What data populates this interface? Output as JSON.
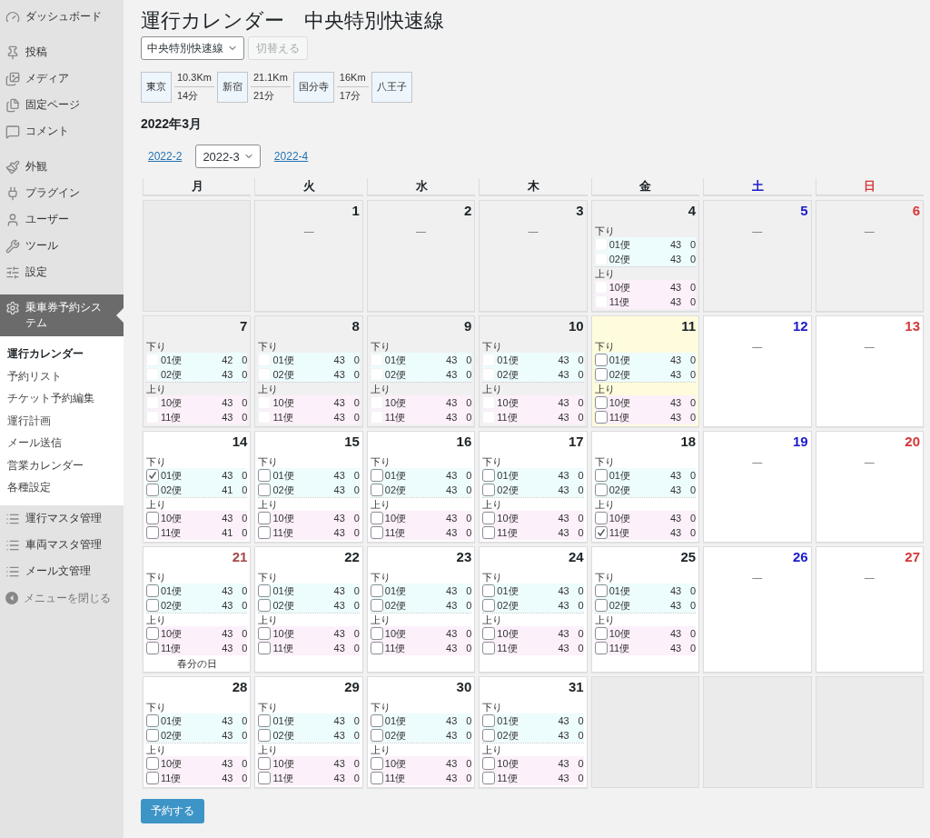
{
  "sidebar": {
    "groups": [
      {
        "items": [
          {
            "label": "ダッシュボード",
            "selected": false
          }
        ]
      },
      {
        "items": [
          {
            "label": "投稿",
            "selected": false
          },
          {
            "label": "メディア",
            "selected": false
          },
          {
            "label": "固定ページ",
            "selected": false
          },
          {
            "label": "コメント",
            "selected": false
          }
        ]
      },
      {
        "items": [
          {
            "label": "外観",
            "selected": false
          },
          {
            "label": "プラグイン",
            "selected": false
          },
          {
            "label": "ユーザー",
            "selected": false
          },
          {
            "label": "ツール",
            "selected": false
          },
          {
            "label": "設定",
            "selected": false
          }
        ]
      },
      {
        "items": [
          {
            "label": "乗車券予約システム",
            "selected": true,
            "submenu": [
              {
                "label": "運行カレンダー",
                "selected": true
              },
              {
                "label": "予約リスト",
                "selected": false
              },
              {
                "label": "チケット予約編集",
                "selected": false
              },
              {
                "label": "運行計画",
                "selected": false
              },
              {
                "label": "メール送信",
                "selected": false
              },
              {
                "label": "営業カレンダー",
                "selected": false
              },
              {
                "label": "各種設定",
                "selected": false
              }
            ]
          },
          {
            "label": "運行マスタ管理",
            "selected": false
          },
          {
            "label": "車両マスタ管理",
            "selected": false
          },
          {
            "label": "メール文管理",
            "selected": false
          },
          {
            "label": "メニューを閉じる",
            "kind": "collapse"
          }
        ]
      }
    ]
  },
  "page_title": "運行カレンダー　中央特別快速線",
  "line_select": {
    "value": "中央特別快速線"
  },
  "switch_button": {
    "label": "切替える",
    "disabled": true
  },
  "route": [
    {
      "kind": "station",
      "name": "東京"
    },
    {
      "kind": "segment",
      "distance": "10.3Km",
      "time": "14分"
    },
    {
      "kind": "station",
      "name": "新宿"
    },
    {
      "kind": "segment",
      "distance": "21.1Km",
      "time": "21分"
    },
    {
      "kind": "station",
      "name": "国分寺"
    },
    {
      "kind": "segment",
      "distance": "16Km",
      "time": "17分"
    },
    {
      "kind": "station",
      "name": "八王子"
    }
  ],
  "month_title": "2022年3月",
  "month_nav": {
    "prev": "2022-2",
    "select": "2022-3",
    "next": "2022-4"
  },
  "weekdays": [
    {
      "label": "月",
      "color": "#1d2327"
    },
    {
      "label": "火",
      "color": "#1d2327"
    },
    {
      "label": "水",
      "color": "#1d2327"
    },
    {
      "label": "木",
      "color": "#1d2327"
    },
    {
      "label": "金",
      "color": "#1d2327"
    },
    {
      "label": "土",
      "color": "#1a1acb"
    },
    {
      "label": "日",
      "color": "#d63638"
    }
  ],
  "cells": [
    {
      "kind": "blank"
    },
    {
      "kind": "closed",
      "day": "1",
      "color": "#1d2327",
      "past": true,
      "today": false,
      "text": "—"
    },
    {
      "kind": "closed",
      "day": "2",
      "color": "#1d2327",
      "past": true,
      "today": false,
      "text": "—"
    },
    {
      "kind": "closed",
      "day": "3",
      "color": "#1d2327",
      "past": true,
      "today": false,
      "text": "—"
    },
    {
      "kind": "service",
      "day": "4",
      "color": "#1d2327",
      "past": true,
      "today": false,
      "sections": [
        {
          "label": "下り",
          "kind": "down",
          "trips": [
            {
              "name": "01便",
              "seats": "43",
              "booked": "0",
              "checked": false
            },
            {
              "name": "02便",
              "seats": "43",
              "booked": "0",
              "checked": false
            }
          ]
        },
        {
          "label": "上り",
          "kind": "up",
          "trips": [
            {
              "name": "10便",
              "seats": "43",
              "booked": "0",
              "checked": false
            },
            {
              "name": "11便",
              "seats": "43",
              "booked": "0",
              "checked": false
            }
          ]
        }
      ]
    },
    {
      "kind": "closed",
      "day": "5",
      "color": "#1a1acb",
      "past": true,
      "today": false,
      "text": "—"
    },
    {
      "kind": "closed",
      "day": "6",
      "color": "#d63638",
      "past": true,
      "today": false,
      "text": "—"
    },
    {
      "kind": "service",
      "day": "7",
      "color": "#1d2327",
      "past": true,
      "today": false,
      "sections": [
        {
          "label": "下り",
          "kind": "down",
          "trips": [
            {
              "name": "01便",
              "seats": "42",
              "booked": "0",
              "checked": false
            },
            {
              "name": "02便",
              "seats": "43",
              "booked": "0",
              "checked": false
            }
          ]
        },
        {
          "label": "上り",
          "kind": "up",
          "trips": [
            {
              "name": "10便",
              "seats": "43",
              "booked": "0",
              "checked": false
            },
            {
              "name": "11便",
              "seats": "43",
              "booked": "0",
              "checked": false
            }
          ]
        }
      ]
    },
    {
      "kind": "service",
      "day": "8",
      "color": "#1d2327",
      "past": true,
      "today": false,
      "sections": [
        {
          "label": "下り",
          "kind": "down",
          "trips": [
            {
              "name": "01便",
              "seats": "43",
              "booked": "0",
              "checked": false
            },
            {
              "name": "02便",
              "seats": "43",
              "booked": "0",
              "checked": false
            }
          ]
        },
        {
          "label": "上り",
          "kind": "up",
          "trips": [
            {
              "name": "10便",
              "seats": "43",
              "booked": "0",
              "checked": false
            },
            {
              "name": "11便",
              "seats": "43",
              "booked": "0",
              "checked": false
            }
          ]
        }
      ]
    },
    {
      "kind": "service",
      "day": "9",
      "color": "#1d2327",
      "past": true,
      "today": false,
      "sections": [
        {
          "label": "下り",
          "kind": "down",
          "trips": [
            {
              "name": "01便",
              "seats": "43",
              "booked": "0",
              "checked": false
            },
            {
              "name": "02便",
              "seats": "43",
              "booked": "0",
              "checked": false
            }
          ]
        },
        {
          "label": "上り",
          "kind": "up",
          "trips": [
            {
              "name": "10便",
              "seats": "43",
              "booked": "0",
              "checked": false
            },
            {
              "name": "11便",
              "seats": "43",
              "booked": "0",
              "checked": false
            }
          ]
        }
      ]
    },
    {
      "kind": "service",
      "day": "10",
      "color": "#1d2327",
      "past": true,
      "today": false,
      "sections": [
        {
          "label": "下り",
          "kind": "down",
          "trips": [
            {
              "name": "01便",
              "seats": "43",
              "booked": "0",
              "checked": false
            },
            {
              "name": "02便",
              "seats": "43",
              "booked": "0",
              "checked": false
            }
          ]
        },
        {
          "label": "上り",
          "kind": "up",
          "trips": [
            {
              "name": "10便",
              "seats": "43",
              "booked": "0",
              "checked": false
            },
            {
              "name": "11便",
              "seats": "43",
              "booked": "0",
              "checked": false
            }
          ]
        }
      ]
    },
    {
      "kind": "service",
      "day": "11",
      "color": "#1d2327",
      "past": false,
      "today": true,
      "sections": [
        {
          "label": "下り",
          "kind": "down",
          "trips": [
            {
              "name": "01便",
              "seats": "43",
              "booked": "0",
              "checked": false
            },
            {
              "name": "02便",
              "seats": "43",
              "booked": "0",
              "checked": false
            }
          ]
        },
        {
          "label": "上り",
          "kind": "up",
          "trips": [
            {
              "name": "10便",
              "seats": "43",
              "booked": "0",
              "checked": false
            },
            {
              "name": "11便",
              "seats": "43",
              "booked": "0",
              "checked": false
            }
          ]
        }
      ]
    },
    {
      "kind": "closed",
      "day": "12",
      "color": "#1a1acb",
      "past": false,
      "today": false,
      "text": "—"
    },
    {
      "kind": "closed",
      "day": "13",
      "color": "#d63638",
      "past": false,
      "today": false,
      "text": "—"
    },
    {
      "kind": "service",
      "day": "14",
      "color": "#1d2327",
      "past": false,
      "today": false,
      "sections": [
        {
          "label": "下り",
          "kind": "down",
          "trips": [
            {
              "name": "01便",
              "seats": "43",
              "booked": "0",
              "checked": true
            },
            {
              "name": "02便",
              "seats": "41",
              "booked": "0",
              "checked": false
            }
          ]
        },
        {
          "label": "上り",
          "kind": "up",
          "trips": [
            {
              "name": "10便",
              "seats": "43",
              "booked": "0",
              "checked": false
            },
            {
              "name": "11便",
              "seats": "41",
              "booked": "0",
              "checked": false
            }
          ]
        }
      ]
    },
    {
      "kind": "service",
      "day": "15",
      "color": "#1d2327",
      "past": false,
      "today": false,
      "sections": [
        {
          "label": "下り",
          "kind": "down",
          "trips": [
            {
              "name": "01便",
              "seats": "43",
              "booked": "0",
              "checked": false
            },
            {
              "name": "02便",
              "seats": "43",
              "booked": "0",
              "checked": false
            }
          ]
        },
        {
          "label": "上り",
          "kind": "up",
          "trips": [
            {
              "name": "10便",
              "seats": "43",
              "booked": "0",
              "checked": false
            },
            {
              "name": "11便",
              "seats": "43",
              "booked": "0",
              "checked": false
            }
          ]
        }
      ]
    },
    {
      "kind": "service",
      "day": "16",
      "color": "#1d2327",
      "past": false,
      "today": false,
      "sections": [
        {
          "label": "下り",
          "kind": "down",
          "trips": [
            {
              "name": "01便",
              "seats": "43",
              "booked": "0",
              "checked": false
            },
            {
              "name": "02便",
              "seats": "43",
              "booked": "0",
              "checked": false
            }
          ]
        },
        {
          "label": "上り",
          "kind": "up",
          "trips": [
            {
              "name": "10便",
              "seats": "43",
              "booked": "0",
              "checked": false
            },
            {
              "name": "11便",
              "seats": "43",
              "booked": "0",
              "checked": false
            }
          ]
        }
      ]
    },
    {
      "kind": "service",
      "day": "17",
      "color": "#1d2327",
      "past": false,
      "today": false,
      "sections": [
        {
          "label": "下り",
          "kind": "down",
          "trips": [
            {
              "name": "01便",
              "seats": "43",
              "booked": "0",
              "checked": false
            },
            {
              "name": "02便",
              "seats": "43",
              "booked": "0",
              "checked": false
            }
          ]
        },
        {
          "label": "上り",
          "kind": "up",
          "trips": [
            {
              "name": "10便",
              "seats": "43",
              "booked": "0",
              "checked": false
            },
            {
              "name": "11便",
              "seats": "43",
              "booked": "0",
              "checked": false
            }
          ]
        }
      ]
    },
    {
      "kind": "service",
      "day": "18",
      "color": "#1d2327",
      "past": false,
      "today": false,
      "sections": [
        {
          "label": "下り",
          "kind": "down",
          "trips": [
            {
              "name": "01便",
              "seats": "43",
              "booked": "0",
              "checked": false
            },
            {
              "name": "02便",
              "seats": "43",
              "booked": "0",
              "checked": false
            }
          ]
        },
        {
          "label": "上り",
          "kind": "up",
          "trips": [
            {
              "name": "10便",
              "seats": "43",
              "booked": "0",
              "checked": false
            },
            {
              "name": "11便",
              "seats": "43",
              "booked": "0",
              "checked": true
            }
          ]
        }
      ]
    },
    {
      "kind": "closed",
      "day": "19",
      "color": "#1a1acb",
      "past": false,
      "today": false,
      "text": "—"
    },
    {
      "kind": "closed",
      "day": "20",
      "color": "#d63638",
      "past": false,
      "today": false,
      "text": "—"
    },
    {
      "kind": "service",
      "day": "21",
      "color": "#a54848",
      "past": false,
      "today": false,
      "note": "春分の日",
      "sections": [
        {
          "label": "下り",
          "kind": "down",
          "trips": [
            {
              "name": "01便",
              "seats": "43",
              "booked": "0",
              "checked": false
            },
            {
              "name": "02便",
              "seats": "43",
              "booked": "0",
              "checked": false
            }
          ]
        },
        {
          "label": "上り",
          "kind": "up",
          "trips": [
            {
              "name": "10便",
              "seats": "43",
              "booked": "0",
              "checked": false
            },
            {
              "name": "11便",
              "seats": "43",
              "booked": "0",
              "checked": false
            }
          ]
        }
      ]
    },
    {
      "kind": "service",
      "day": "22",
      "color": "#1d2327",
      "past": false,
      "today": false,
      "sections": [
        {
          "label": "下り",
          "kind": "down",
          "trips": [
            {
              "name": "01便",
              "seats": "43",
              "booked": "0",
              "checked": false
            },
            {
              "name": "02便",
              "seats": "43",
              "booked": "0",
              "checked": false
            }
          ]
        },
        {
          "label": "上り",
          "kind": "up",
          "trips": [
            {
              "name": "10便",
              "seats": "43",
              "booked": "0",
              "checked": false
            },
            {
              "name": "11便",
              "seats": "43",
              "booked": "0",
              "checked": false
            }
          ]
        }
      ]
    },
    {
      "kind": "service",
      "day": "23",
      "color": "#1d2327",
      "past": false,
      "today": false,
      "sections": [
        {
          "label": "下り",
          "kind": "down",
          "trips": [
            {
              "name": "01便",
              "seats": "43",
              "booked": "0",
              "checked": false
            },
            {
              "name": "02便",
              "seats": "43",
              "booked": "0",
              "checked": false
            }
          ]
        },
        {
          "label": "上り",
          "kind": "up",
          "trips": [
            {
              "name": "10便",
              "seats": "43",
              "booked": "0",
              "checked": false
            },
            {
              "name": "11便",
              "seats": "43",
              "booked": "0",
              "checked": false
            }
          ]
        }
      ]
    },
    {
      "kind": "service",
      "day": "24",
      "color": "#1d2327",
      "past": false,
      "today": false,
      "sections": [
        {
          "label": "下り",
          "kind": "down",
          "trips": [
            {
              "name": "01便",
              "seats": "43",
              "booked": "0",
              "checked": false
            },
            {
              "name": "02便",
              "seats": "43",
              "booked": "0",
              "checked": false
            }
          ]
        },
        {
          "label": "上り",
          "kind": "up",
          "trips": [
            {
              "name": "10便",
              "seats": "43",
              "booked": "0",
              "checked": false
            },
            {
              "name": "11便",
              "seats": "43",
              "booked": "0",
              "checked": false
            }
          ]
        }
      ]
    },
    {
      "kind": "service",
      "day": "25",
      "color": "#1d2327",
      "past": false,
      "today": false,
      "sections": [
        {
          "label": "下り",
          "kind": "down",
          "trips": [
            {
              "name": "01便",
              "seats": "43",
              "booked": "0",
              "checked": false
            },
            {
              "name": "02便",
              "seats": "43",
              "booked": "0",
              "checked": false
            }
          ]
        },
        {
          "label": "上り",
          "kind": "up",
          "trips": [
            {
              "name": "10便",
              "seats": "43",
              "booked": "0",
              "checked": false
            },
            {
              "name": "11便",
              "seats": "43",
              "booked": "0",
              "checked": false
            }
          ]
        }
      ]
    },
    {
      "kind": "closed",
      "day": "26",
      "color": "#1a1acb",
      "past": false,
      "today": false,
      "text": "—"
    },
    {
      "kind": "closed",
      "day": "27",
      "color": "#d63638",
      "past": false,
      "today": false,
      "text": "—"
    },
    {
      "kind": "service",
      "day": "28",
      "color": "#1d2327",
      "past": false,
      "today": false,
      "sections": [
        {
          "label": "下り",
          "kind": "down",
          "trips": [
            {
              "name": "01便",
              "seats": "43",
              "booked": "0",
              "checked": false
            },
            {
              "name": "02便",
              "seats": "43",
              "booked": "0",
              "checked": false
            }
          ]
        },
        {
          "label": "上り",
          "kind": "up",
          "trips": [
            {
              "name": "10便",
              "seats": "43",
              "booked": "0",
              "checked": false
            },
            {
              "name": "11便",
              "seats": "43",
              "booked": "0",
              "checked": false
            }
          ]
        }
      ]
    },
    {
      "kind": "service",
      "day": "29",
      "color": "#1d2327",
      "past": false,
      "today": false,
      "sections": [
        {
          "label": "下り",
          "kind": "down",
          "trips": [
            {
              "name": "01便",
              "seats": "43",
              "booked": "0",
              "checked": false
            },
            {
              "name": "02便",
              "seats": "43",
              "booked": "0",
              "checked": false
            }
          ]
        },
        {
          "label": "上り",
          "kind": "up",
          "trips": [
            {
              "name": "10便",
              "seats": "43",
              "booked": "0",
              "checked": false
            },
            {
              "name": "11便",
              "seats": "43",
              "booked": "0",
              "checked": false
            }
          ]
        }
      ]
    },
    {
      "kind": "service",
      "day": "30",
      "color": "#1d2327",
      "past": false,
      "today": false,
      "sections": [
        {
          "label": "下り",
          "kind": "down",
          "trips": [
            {
              "name": "01便",
              "seats": "43",
              "booked": "0",
              "checked": false
            },
            {
              "name": "02便",
              "seats": "43",
              "booked": "0",
              "checked": false
            }
          ]
        },
        {
          "label": "上り",
          "kind": "up",
          "trips": [
            {
              "name": "10便",
              "seats": "43",
              "booked": "0",
              "checked": false
            },
            {
              "name": "11便",
              "seats": "43",
              "booked": "0",
              "checked": false
            }
          ]
        }
      ]
    },
    {
      "kind": "service",
      "day": "31",
      "color": "#1d2327",
      "past": false,
      "today": false,
      "sections": [
        {
          "label": "下り",
          "kind": "down",
          "trips": [
            {
              "name": "01便",
              "seats": "43",
              "booked": "0",
              "checked": false
            },
            {
              "name": "02便",
              "seats": "43",
              "booked": "0",
              "checked": false
            }
          ]
        },
        {
          "label": "上り",
          "kind": "up",
          "trips": [
            {
              "name": "10便",
              "seats": "43",
              "booked": "0",
              "checked": false
            },
            {
              "name": "11便",
              "seats": "43",
              "booked": "0",
              "checked": false
            }
          ]
        }
      ]
    },
    {
      "kind": "blank"
    },
    {
      "kind": "blank"
    },
    {
      "kind": "blank"
    }
  ],
  "submit_button": {
    "label": "予約する"
  }
}
